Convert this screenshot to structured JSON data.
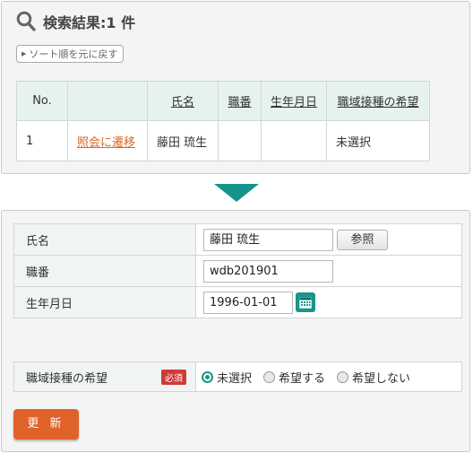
{
  "search": {
    "title": "検索結果:1 件",
    "sort_reset_label": "ソート順を元に戻す"
  },
  "results_table": {
    "headers": [
      "No.",
      "",
      "氏名",
      "職番",
      "生年月日",
      "職域接種の希望"
    ],
    "rows": [
      {
        "no": "1",
        "link": "照会に遷移",
        "name": "藤田 琉生",
        "staff_no": "",
        "birth_date": "",
        "wish": "未選択"
      }
    ]
  },
  "form": {
    "name_label": "氏名",
    "name_value": "藤田 琉生",
    "reference_button": "参照",
    "staff_no_label": "職番",
    "staff_no_value": "wdb201901",
    "birth_label": "生年月日",
    "birth_value": "1996-01-01",
    "wish_label": "職域接種の希望",
    "required_badge": "必須",
    "wish_options": [
      "未選択",
      "希望する",
      "希望しない"
    ],
    "wish_selected": "未選択",
    "update_button": "更 新"
  },
  "colors": {
    "accent_teal": "#17958d",
    "link_orange": "#d9682a",
    "update_orange": "#e0632a",
    "required_red": "#cf3a3a"
  },
  "icons": [
    "search-icon",
    "calendar-icon",
    "down-arrow-icon"
  ]
}
